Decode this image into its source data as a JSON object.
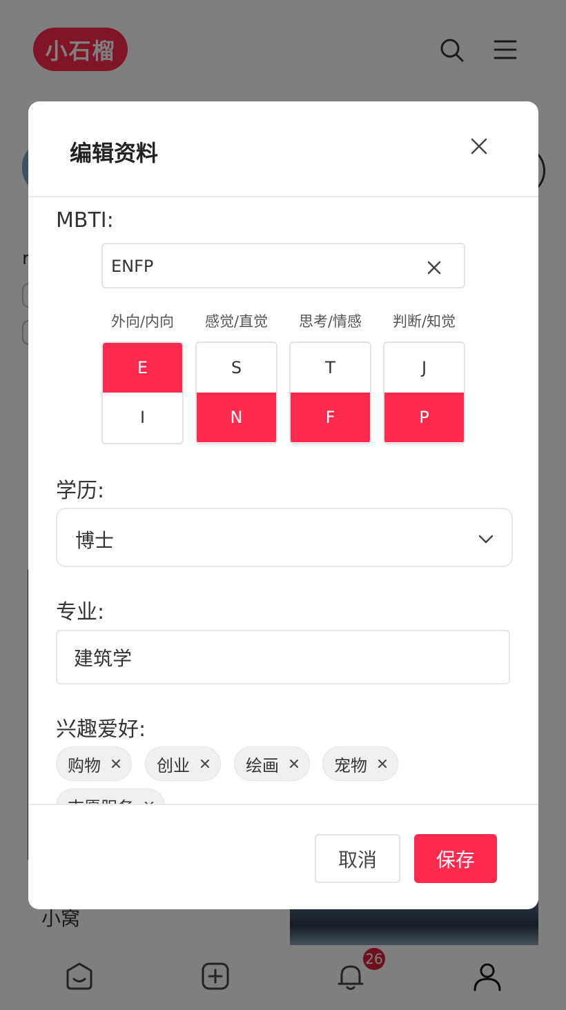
{
  "app": {
    "logo_text": "小石榴"
  },
  "background": {
    "fragment_text": "rī",
    "card_label": "小窝"
  },
  "nav": {
    "badge_count": "26"
  },
  "modal": {
    "title": "编辑资料",
    "mbti": {
      "label": "MBTI:",
      "value": "ENFP",
      "dimensions": [
        {
          "label": "外向/内向",
          "options": [
            "E",
            "I"
          ],
          "selected": "E"
        },
        {
          "label": "感觉/直觉",
          "options": [
            "S",
            "N"
          ],
          "selected": "N"
        },
        {
          "label": "思考/情感",
          "options": [
            "T",
            "F"
          ],
          "selected": "F"
        },
        {
          "label": "判断/知觉",
          "options": [
            "J",
            "P"
          ],
          "selected": "P"
        }
      ]
    },
    "education": {
      "label": "学历:",
      "value": "博士"
    },
    "major": {
      "label": "专业:",
      "value": "建筑学"
    },
    "hobbies": {
      "label": "兴趣爱好:",
      "tags": [
        "购物",
        "创业",
        "绘画",
        "宠物",
        "志愿服务"
      ]
    },
    "footer": {
      "cancel_label": "取消",
      "save_label": "保存"
    }
  },
  "colors": {
    "accent": "#ff2a4d",
    "badge": "#d81e3c"
  }
}
